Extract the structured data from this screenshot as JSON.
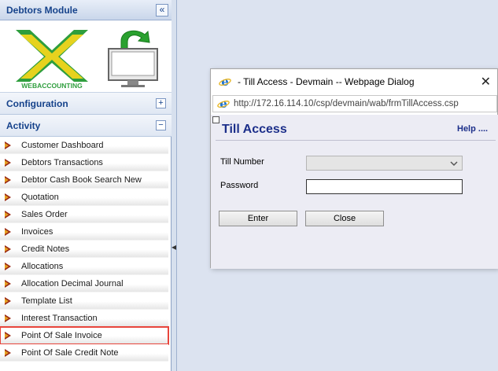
{
  "sidebar": {
    "module_title": "Debtors Module",
    "collapse_icon": "double-chevron-left-icon",
    "logo_text": "WEBACCOUNTING",
    "configuration": {
      "title": "Configuration",
      "toggle": "+"
    },
    "activity": {
      "title": "Activity",
      "toggle": "−"
    },
    "items": [
      {
        "label": "Customer Dashboard"
      },
      {
        "label": "Debtors Transactions"
      },
      {
        "label": "Debtor Cash Book Search New"
      },
      {
        "label": "Quotation"
      },
      {
        "label": "Sales Order"
      },
      {
        "label": "Invoices"
      },
      {
        "label": "Credit Notes"
      },
      {
        "label": "Allocations"
      },
      {
        "label": "Allocation Decimal Journal"
      },
      {
        "label": "Template List"
      },
      {
        "label": "Interest Transaction"
      },
      {
        "label": "Point Of Sale Invoice"
      },
      {
        "label": "Point Of Sale Credit Note"
      }
    ],
    "highlighted_item": "Point Of Sale Invoice",
    "highlight_color": "#e8453c"
  },
  "dialog": {
    "title": "- Till Access - Devmain -- Webpage Dialog",
    "url": "http://172.16.114.10/csp/devmain/wab/frmTillAccess.csp",
    "heading": "Till Access",
    "help_link": "Help ....",
    "till_number": {
      "label": "Till Number",
      "value": ""
    },
    "password": {
      "label": "Password",
      "value": ""
    },
    "enter_label": "Enter",
    "close_label": "Close",
    "close_glyph": "✕"
  },
  "colors": {
    "heading_blue": "#1c2f8a",
    "sidebar_title_blue": "#15428b",
    "main_background": "#dce3f0"
  }
}
